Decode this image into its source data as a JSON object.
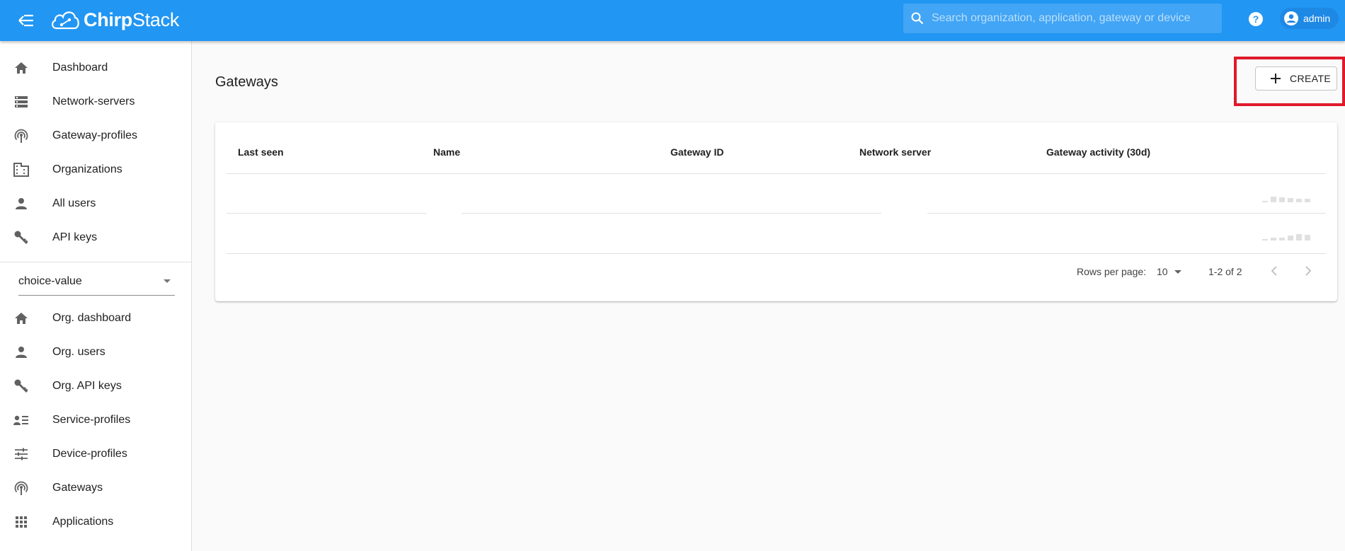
{
  "app": {
    "brand_bold": "Chirp",
    "brand_rest": "Stack"
  },
  "search": {
    "placeholder": "Search organization, application, gateway or device"
  },
  "user": {
    "name": "admin"
  },
  "sidebar": {
    "items": [
      {
        "label": "Dashboard",
        "icon": "home-icon"
      },
      {
        "label": "Network-servers",
        "icon": "server-icon"
      },
      {
        "label": "Gateway-profiles",
        "icon": "gateway-icon"
      },
      {
        "label": "Organizations",
        "icon": "building-icon"
      },
      {
        "label": "All users",
        "icon": "person-icon"
      },
      {
        "label": "API keys",
        "icon": "key-icon"
      }
    ],
    "org_select": {
      "value": "choice-value"
    },
    "org_items": [
      {
        "label": "Org. dashboard",
        "icon": "home-icon"
      },
      {
        "label": "Org. users",
        "icon": "person-icon"
      },
      {
        "label": "Org. API keys",
        "icon": "key-icon"
      },
      {
        "label": "Service-profiles",
        "icon": "service-profile-icon"
      },
      {
        "label": "Device-profiles",
        "icon": "tune-icon"
      },
      {
        "label": "Gateways",
        "icon": "gateway-icon"
      },
      {
        "label": "Applications",
        "icon": "apps-icon"
      }
    ]
  },
  "main": {
    "title": "Gateways",
    "create_label": "CREATE",
    "table": {
      "headers": [
        "Last seen",
        "Name",
        "Gateway ID",
        "Network server",
        "Gateway activity (30d)"
      ],
      "rows": [
        {
          "last_seen": "",
          "name": "",
          "gateway_id": "",
          "network_server": ""
        },
        {
          "last_seen": "",
          "name": "",
          "gateway_id": "",
          "network_server": ""
        }
      ],
      "rows_per_page_label": "Rows per page:",
      "rows_per_page": "10",
      "range": "1-2 of 2"
    }
  },
  "colors": {
    "primary": "#2196f3",
    "highlight": "#e0192a"
  }
}
